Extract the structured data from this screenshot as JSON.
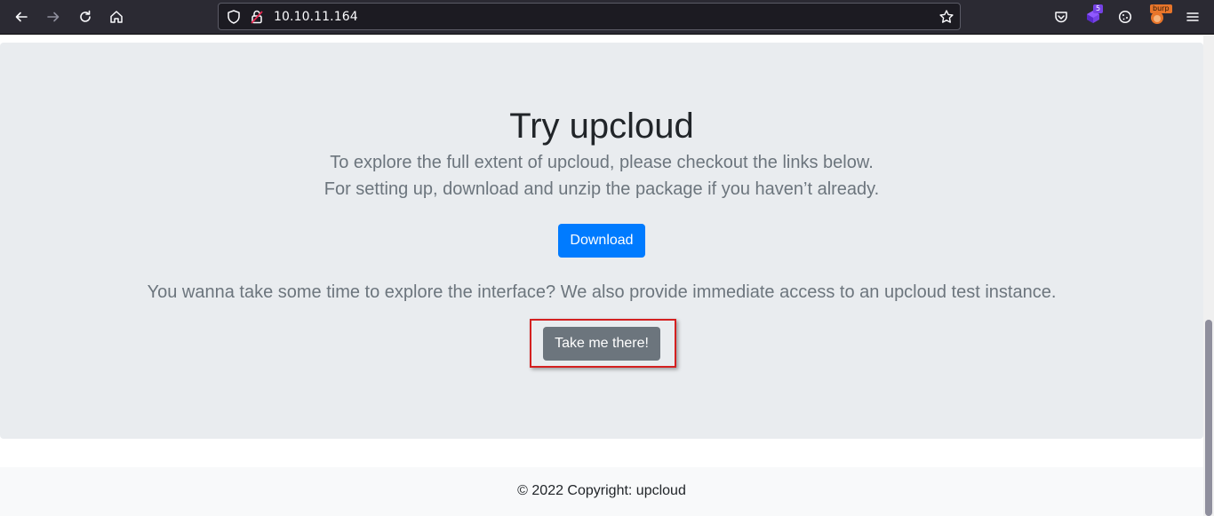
{
  "browser": {
    "url": "10.10.11.164",
    "extensions": {
      "privacy_badge_count": "5",
      "burp_label": "burp"
    }
  },
  "jumbotron": {
    "title": "Try upcloud",
    "lead_line1": "To explore the full extent of upcloud, please checkout the links below.",
    "lead_line2": "For setting up, download and unzip the package if you haven’t already.",
    "download_label": "Download",
    "explore_text": "You wanna take some time to explore the interface? We also provide immediate access to an upcloud test instance.",
    "take_me_label": "Take me there!"
  },
  "footer": {
    "copyright": "© 2022 Copyright: upcloud"
  },
  "colors": {
    "primary": "#007bff",
    "secondary": "#6c757d",
    "highlight": "#d42020",
    "jumbotron_bg": "#e9ecef"
  }
}
